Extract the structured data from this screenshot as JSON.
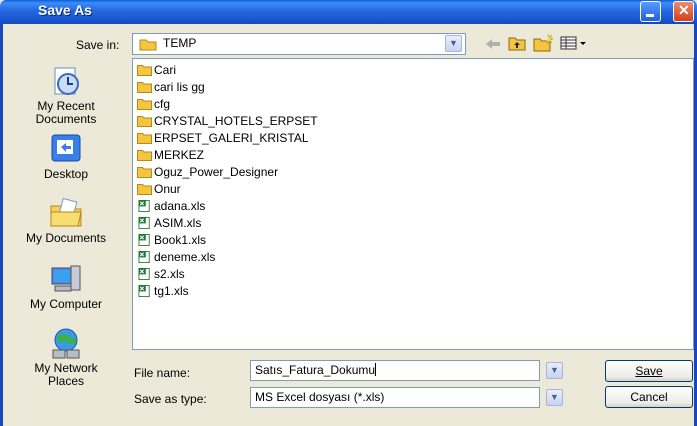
{
  "window": {
    "title": "Save As"
  },
  "toolbar": {
    "save_in_label": "Save in:",
    "save_in_value": "TEMP",
    "icons": [
      "back-icon",
      "up-folder-icon",
      "new-folder-icon",
      "views-menu-icon"
    ]
  },
  "places": [
    {
      "label": "My Recent Documents",
      "icon": "recent-documents-icon"
    },
    {
      "label": "Desktop",
      "icon": "desktop-icon"
    },
    {
      "label": "My Documents",
      "icon": "my-documents-icon"
    },
    {
      "label": "My Computer",
      "icon": "my-computer-icon"
    },
    {
      "label": "My Network Places",
      "icon": "network-places-icon"
    }
  ],
  "files": [
    {
      "name": "Cari",
      "type": "folder"
    },
    {
      "name": "cari lis gg",
      "type": "folder"
    },
    {
      "name": "cfg",
      "type": "folder"
    },
    {
      "name": "CRYSTAL_HOTELS_ERPSET",
      "type": "folder"
    },
    {
      "name": "ERPSET_GALERI_KRISTAL",
      "type": "folder"
    },
    {
      "name": "MERKEZ",
      "type": "folder"
    },
    {
      "name": "Oguz_Power_Designer",
      "type": "folder"
    },
    {
      "name": "Onur",
      "type": "folder"
    },
    {
      "name": "adana.xls",
      "type": "excel"
    },
    {
      "name": "ASIM.xls",
      "type": "excel"
    },
    {
      "name": "Book1.xls",
      "type": "excel"
    },
    {
      "name": "deneme.xls",
      "type": "excel"
    },
    {
      "name": "s2.xls",
      "type": "excel"
    },
    {
      "name": "tg1.xls",
      "type": "excel"
    }
  ],
  "form": {
    "file_name_label": "File name:",
    "file_name_value": "Satıs_Fatura_Dokumu",
    "save_as_type_label": "Save as type:",
    "save_as_type_value": "MS Excel dosyası (*.xls)",
    "save_button": "Save",
    "cancel_button": "Cancel"
  },
  "colors": {
    "titlebar": "#2467e0",
    "dialog_bg": "#ece9d8",
    "folder": "#f5c542",
    "excel": "#1e7b34"
  }
}
